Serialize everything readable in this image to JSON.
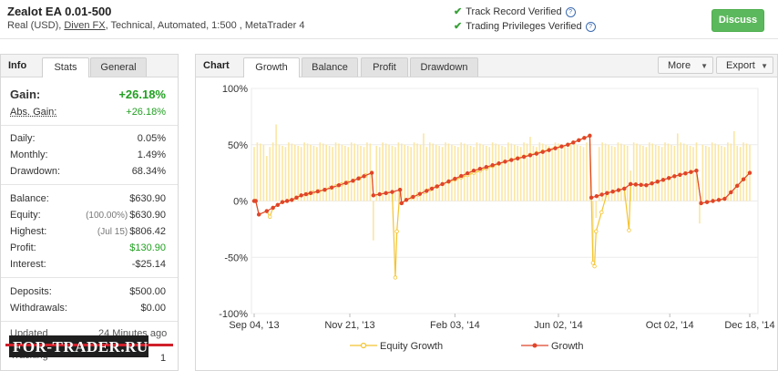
{
  "header": {
    "system_name": "Zealot EA 0.01-500",
    "meta_prefix": "Real (USD), ",
    "broker": "Diven FX",
    "meta_suffix": ", Technical, Automated, 1:500 , MetaTrader 4",
    "track_record": "Track Record Verified",
    "trading_privileges": "Trading Privileges Verified",
    "discuss_label": "Discuss"
  },
  "info_panel": {
    "title": "Info",
    "tabs": [
      "Stats",
      "General"
    ],
    "active_tab": "Stats",
    "gain_label": "Gain:",
    "gain_value": "+26.18%",
    "abs_gain_label": "Abs. Gain:",
    "abs_gain_value": "+26.18%",
    "daily_label": "Daily:",
    "daily_value": "0.05%",
    "monthly_label": "Monthly:",
    "monthly_value": "1.49%",
    "drawdown_label": "Drawdown:",
    "drawdown_value": "68.34%",
    "balance_label": "Balance:",
    "balance_value": "$630.90",
    "equity_label": "Equity:",
    "equity_note": "(100.00%)",
    "equity_value": "$630.90",
    "highest_label": "Highest:",
    "highest_note": "(Jul 15)",
    "highest_value": "$806.42",
    "profit_label": "Profit:",
    "profit_value": "$130.90",
    "interest_label": "Interest:",
    "interest_value": "-$25.14",
    "deposits_label": "Deposits:",
    "deposits_value": "$500.00",
    "withdrawals_label": "Withdrawals:",
    "withdrawals_value": "$0.00",
    "updated_partial": "Updated",
    "updated_value_partial": "24 Minutes ago",
    "tracking_partial": "Tracking",
    "tracking_value": "1",
    "watermark": "FOR-TRADER.RU"
  },
  "chart_panel": {
    "title": "Chart",
    "tabs": [
      "Growth",
      "Balance",
      "Profit",
      "Drawdown"
    ],
    "active_tab": "Growth",
    "more_label": "More",
    "export_label": "Export"
  },
  "colors": {
    "growth_line": "#e0452b",
    "equity_line": "#f4c430",
    "bars": "#fbe6a2",
    "accent_green": "#22a022",
    "discuss_button": "#5cb85c"
  },
  "chart_data": {
    "type": "line",
    "title": "",
    "xlabel": "",
    "ylabel": "",
    "x_tick_labels": [
      "Sep 04, '13",
      "Nov 21, '13",
      "Feb 03, '14",
      "Jun 02, '14",
      "Oct 02, '14",
      "Dec 18, '14"
    ],
    "y_tick_labels": [
      "100%",
      "50%",
      "0%",
      "-50%",
      "-100%"
    ],
    "y_ticks": [
      100,
      50,
      0,
      -50,
      -100
    ],
    "ylim": [
      -100,
      100
    ],
    "grid": true,
    "legend_position": "bottom",
    "legend": [
      "Equity Growth",
      "Growth"
    ],
    "series": [
      {
        "name": "Growth",
        "x": [
          0,
          1,
          3,
          8,
          12,
          18,
          24,
          30,
          36,
          45,
          54,
          63,
          70,
          75,
          76,
          88,
          93,
          94,
          97,
          110,
          120,
          140,
          160,
          180,
          200,
          214,
          215,
          225,
          236,
          240,
          250,
          268,
          282,
          285,
          300,
          316
        ],
        "values": [
          0,
          0,
          -12,
          -9,
          -6,
          -1,
          1,
          5,
          7,
          10,
          14,
          18,
          22,
          25,
          5,
          8,
          10,
          -2,
          1,
          9,
          15,
          27,
          35,
          42,
          50,
          58,
          3,
          7,
          11,
          15,
          14,
          22,
          27,
          -2,
          2,
          25
        ]
      },
      {
        "name": "Equity Growth",
        "x": [
          0,
          1,
          3,
          8,
          10,
          12,
          18,
          24,
          30,
          45,
          63,
          75,
          76,
          88,
          90,
          91,
          93,
          94,
          97,
          120,
          160,
          200,
          214,
          215,
          216,
          217,
          218,
          225,
          236,
          239,
          240,
          250,
          268,
          282,
          285,
          300,
          316
        ],
        "values": [
          0,
          0,
          -12,
          -9,
          -14,
          -6,
          -1,
          1,
          5,
          10,
          18,
          25,
          5,
          8,
          -68,
          -27,
          10,
          -2,
          1,
          15,
          35,
          50,
          58,
          3,
          -55,
          -58,
          -27,
          7,
          11,
          -26,
          15,
          14,
          22,
          27,
          -2,
          2,
          25
        ]
      }
    ],
    "bars": {
      "name": "",
      "x_range": [
        0,
        316
      ],
      "baseline_value": 50,
      "spikes_down": [
        {
          "x": 3,
          "value": 10
        },
        {
          "x": 8,
          "value": 40
        },
        {
          "x": 76,
          "value": -35
        },
        {
          "x": 91,
          "value": -68
        },
        {
          "x": 93,
          "value": 13
        },
        {
          "x": 137,
          "value": 43
        },
        {
          "x": 215,
          "value": -57
        },
        {
          "x": 216,
          "value": -55
        },
        {
          "x": 218,
          "value": -15
        },
        {
          "x": 229,
          "value": 32
        },
        {
          "x": 239,
          "value": 40
        },
        {
          "x": 240,
          "value": 27
        },
        {
          "x": 284,
          "value": -20
        }
      ],
      "spikes_up": [
        {
          "x": 14,
          "value": 68
        },
        {
          "x": 108,
          "value": 60
        },
        {
          "x": 176,
          "value": 57
        },
        {
          "x": 270,
          "value": 60
        },
        {
          "x": 306,
          "value": 62
        }
      ]
    }
  }
}
